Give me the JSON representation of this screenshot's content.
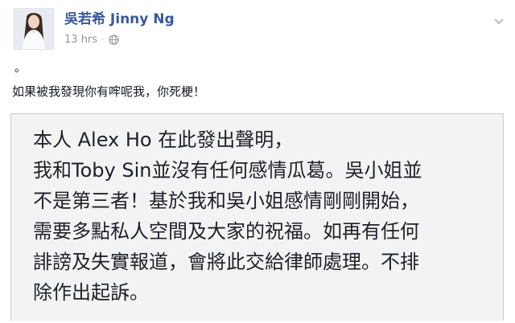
{
  "post": {
    "author": "吳若希 Jinny Ng",
    "timestamp": "13 hrs",
    "separator": "·",
    "privacy_icon": "globe-icon",
    "options_icon": "chevron-down-icon",
    "status_mark": "。",
    "status_text": "如果被我發現你有哰呢我，你死梗！",
    "statement_lines": [
      "本人 Alex Ho 在此發出聲明，",
      "我和Toby Sin並沒有任何感情瓜葛。吳小姐並",
      "不是第三者！基於我和吳小姐感情剛剛開始，",
      "需要多點私人空間及大家的祝福。如再有任何",
      "誹謗及失實報道，會將此交給律師處理。不排",
      "除作出起訴。"
    ]
  },
  "colors": {
    "author_link": "#3b5998",
    "meta_gray": "#9197a3",
    "card_background": "#f3f3f3",
    "card_border": "#c9ccd1"
  }
}
